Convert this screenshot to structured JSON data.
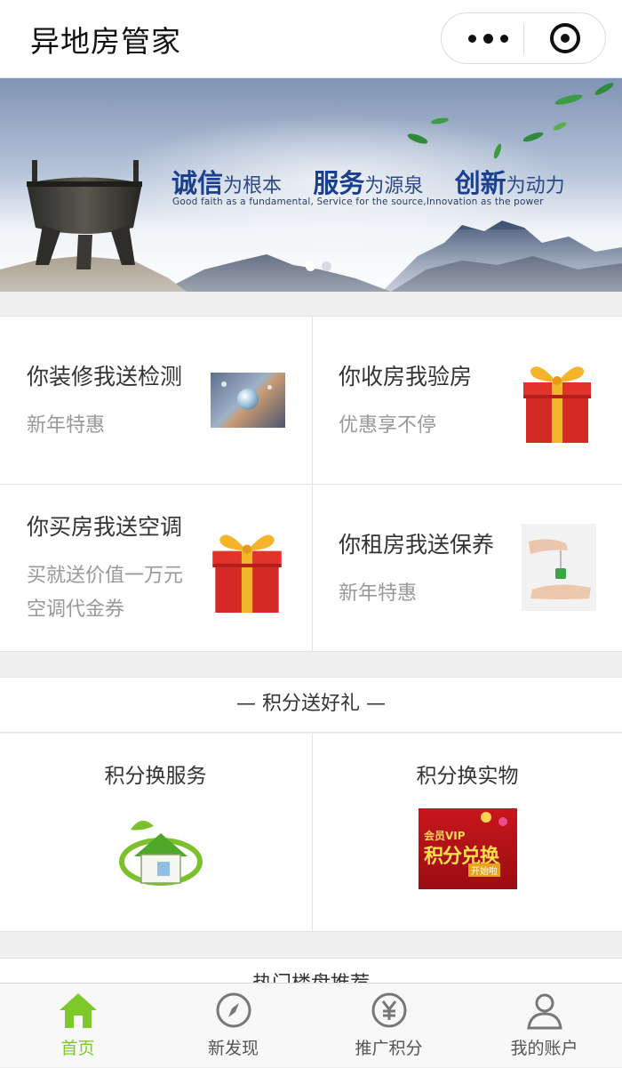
{
  "nav": {
    "title": "异地房管家",
    "more_icon": "more-dots-icon",
    "close_icon": "target-close-icon"
  },
  "banner": {
    "slogan": [
      {
        "big": "诚信",
        "small": "为根本"
      },
      {
        "big": "服务",
        "small": "为源泉"
      },
      {
        "big": "创新",
        "small": "为动力"
      }
    ],
    "slogan_en": "Good faith as a fundamental, Service for the source,Innovation as the power",
    "active_dot_color": "#ffffff",
    "dot_color": "#9aa6b8"
  },
  "promos": [
    {
      "title": "你装修我送检测",
      "subtitle": [
        "新年特惠"
      ],
      "icon": "water-droplet-image"
    },
    {
      "title": "你收房我验房",
      "subtitle": [
        "优惠享不停"
      ],
      "icon": "gift-box-icon"
    },
    {
      "title": "你买房我送空调",
      "subtitle": [
        "买就送价值一万元",
        "空调代金券"
      ],
      "icon": "gift-box-icon"
    },
    {
      "title": "你租房我送保养",
      "subtitle": [
        "新年特惠"
      ],
      "icon": "key-handover-image"
    }
  ],
  "points_section": {
    "heading": "— 积分送好礼 —",
    "items": [
      {
        "title": "积分换服务",
        "icon": "green-house-icon"
      },
      {
        "title": "积分换实物",
        "icon": "vip-exchange-poster",
        "poster_text": [
          "会员VIP",
          "积分兑换",
          "开始啦"
        ]
      }
    ]
  },
  "hot": {
    "heading": "热门楼盘推荐"
  },
  "tabbar": {
    "accent": "#7ec82a",
    "items": [
      {
        "label": "首页",
        "icon": "home-icon",
        "active": true
      },
      {
        "label": "新发现",
        "icon": "compass-icon",
        "active": false
      },
      {
        "label": "推广积分",
        "icon": "yen-coin-icon",
        "active": false
      },
      {
        "label": "我的账户",
        "icon": "user-icon",
        "active": false
      }
    ]
  }
}
